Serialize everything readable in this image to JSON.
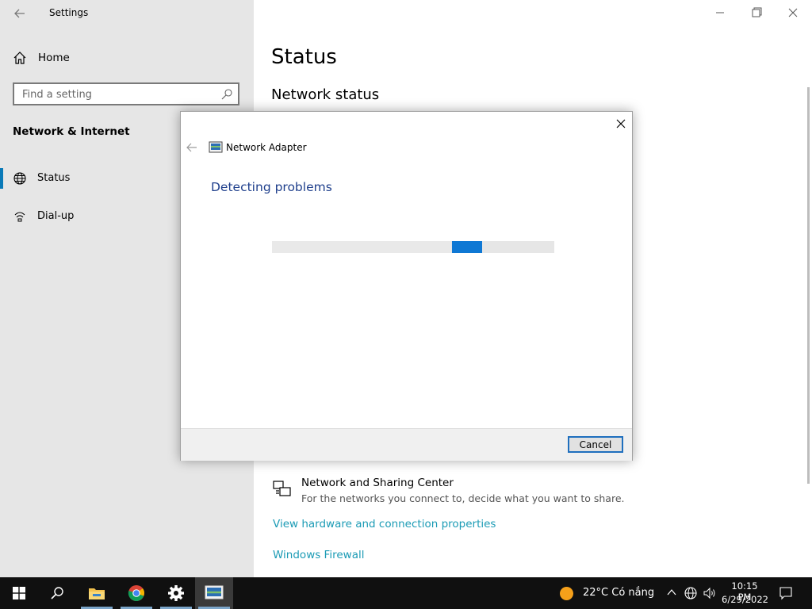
{
  "window": {
    "title": "Settings"
  },
  "sidebar": {
    "home_label": "Home",
    "search_placeholder": "Find a setting",
    "section_heading": "Network & Internet",
    "items": [
      {
        "label": "Status",
        "icon": "globe-icon",
        "selected": true
      },
      {
        "label": "Dial-up",
        "icon": "dialup-icon",
        "selected": false
      }
    ]
  },
  "main": {
    "title": "Status",
    "subtitle": "Network status",
    "network_center": {
      "title": "Network and Sharing Center",
      "description": "For the networks you connect to, decide what you want to share."
    },
    "links": [
      "View hardware and connection properties",
      "Windows Firewall"
    ]
  },
  "dialog": {
    "app_title": "Network Adapter",
    "heading": "Detecting problems",
    "cancel_label": "Cancel",
    "progress_indeterminate": true
  },
  "taskbar": {
    "apps": [
      "windows-start-icon",
      "search-icon",
      "file-explorer-icon",
      "chrome-icon",
      "settings-gear-icon",
      "troubleshooter-icon"
    ],
    "weather": "22°C  Có nắng",
    "time": "10:15 PM",
    "date": "6/29/2022"
  },
  "colors": {
    "accent": "#0f78d4",
    "link": "#1b9bb5",
    "dialog_heading": "#1f3f8c",
    "sidebar_bg": "#e6e6e6",
    "taskbar_bg": "#101010",
    "selection_bar": "#0a7ab8"
  }
}
